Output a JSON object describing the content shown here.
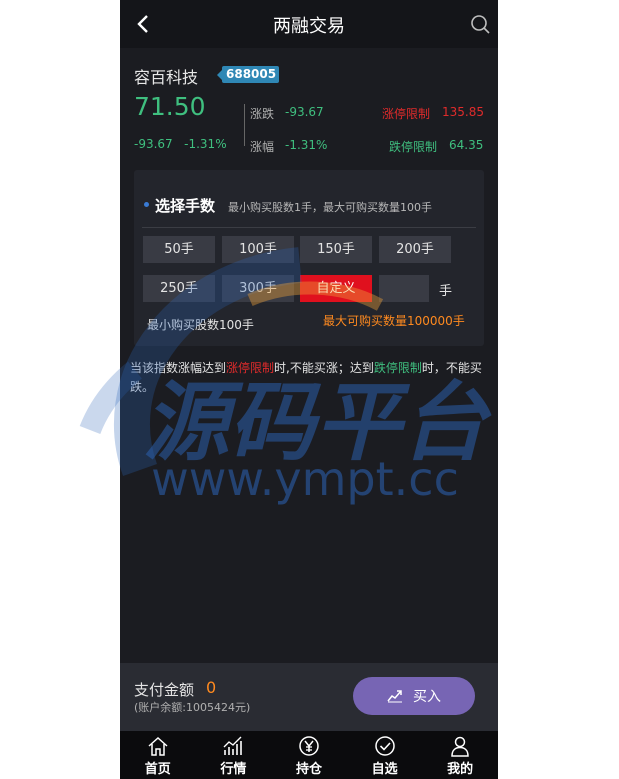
{
  "header": {
    "title": "两融交易",
    "back_icon": "chevron-left-icon",
    "search_icon": "search-icon"
  },
  "stock": {
    "name": "容百科技",
    "code": "688005",
    "price": "71.50",
    "change": "-93.67",
    "change_pct": "-1.31%",
    "change_label": "涨跌",
    "change_value": "-93.67",
    "pct_label": "涨幅",
    "pct_value": "-1.31%",
    "limit_up_label": "涨停限制",
    "limit_up_value": "135.85",
    "limit_down_label": "跌停限制",
    "limit_down_value": "64.35"
  },
  "lots_panel": {
    "title": "选择手数",
    "hint": "最小购买股数1手，最大可购买数量100手",
    "options": [
      "50手",
      "100手",
      "150手",
      "200手",
      "250手",
      "300手",
      "自定义"
    ],
    "selected": "自定义",
    "custom_value": "",
    "unit": "手",
    "min_note": "最小购买股数100手",
    "max_note": "最大可购买数量100000手"
  },
  "notice": {
    "p1": "当该指数涨幅达到",
    "limit_up": "涨停限制",
    "p2": "时,不能买涨；达到",
    "limit_down": "跌停限制",
    "p3": "时，不能买跌。"
  },
  "watermark": {
    "text": "源码平台",
    "url": "www.ympt.cc"
  },
  "payment": {
    "label": "支付金额",
    "amount": "0",
    "balance": "(账户余额:1005424元)",
    "buy_label": "买入"
  },
  "tabbar": [
    {
      "label": "首页",
      "icon": "home-icon"
    },
    {
      "label": "行情",
      "icon": "market-chart-icon"
    },
    {
      "label": "持仓",
      "icon": "yen-coin-icon"
    },
    {
      "label": "自选",
      "icon": "check-circle-icon"
    },
    {
      "label": "我的",
      "icon": "user-icon"
    }
  ],
  "colors": {
    "up": "#e02b2b",
    "down": "#3fbf7f",
    "accent": "#ff8a1f",
    "buy": "#7765b4",
    "selected": "#e0101e"
  }
}
